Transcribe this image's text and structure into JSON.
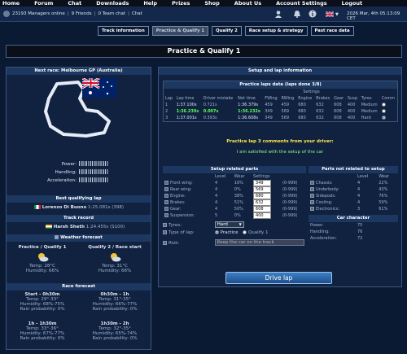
{
  "nav": [
    "Home",
    "Forum",
    "Chat",
    "Downloads",
    "Help",
    "Prizes",
    "Shop",
    "About Us",
    "Account Settings",
    "Logout"
  ],
  "status": {
    "managers_online": "23193 Managers online",
    "friends": "9 Friends",
    "team_chat": "0 Team chat",
    "chat": "Chat",
    "datetime": "2026 Mar, 4th 05:13:09 CET"
  },
  "tabs": [
    "Track information",
    "Practice & Qualify 1",
    "Qualify 2",
    "Race setup & strategy",
    "Past race data"
  ],
  "page_title": "Practice & Qualify 1",
  "left": {
    "next_race": "Next race: Melbourne GP (Australia)",
    "attributes": [
      {
        "label": "Power:",
        "level": 0.3
      },
      {
        "label": "Handling:",
        "level": 0.3
      },
      {
        "label": "Acceleration:",
        "level": 0.3
      }
    ],
    "best_qual_header": "Best qualifying lap",
    "best_qual_driver": "Lorenzo Di Buono",
    "best_qual_time": "1:25.081s (398)",
    "track_record_header": "Track record",
    "track_record_driver": "Harsh Sheth",
    "track_record_time": "1:24.455s (S100)",
    "weather_header": "Weather forecast",
    "weather_cols": [
      {
        "title": "Practice / Qualify 1",
        "temp": "Temp: 28°C",
        "humidity": "Humidity: 66%"
      },
      {
        "title": "Qualify 2 / Race start",
        "temp": "Temp: 31°C",
        "humidity": "Humidity: 66%"
      }
    ],
    "race_forecast_header": "Race forecast",
    "race_forecast": [
      {
        "title": "Start - 0h30m",
        "temp": "Temp: 29°-33°",
        "humidity": "Humidity: 68%-75%",
        "rain": "Rain probability: 0%"
      },
      {
        "title": "0h30m - 1h",
        "temp": "Temp: 31°-35°",
        "humidity": "Humidity: 66%-77%",
        "rain": "Rain probability: 0%"
      },
      {
        "title": "1h - 1h30m",
        "temp": "Temp: 33°-36°",
        "humidity": "Humidity: 67%-77%",
        "rain": "Rain probability: 0%"
      },
      {
        "title": "1h30m - 2h",
        "temp": "Temp: 32°-35°",
        "humidity": "Humidity: 65%-74%",
        "rain": "Rain probability: 0%"
      }
    ]
  },
  "right": {
    "setup_header": "Setup and lap information",
    "laps_header": "Practice laps data (laps done 3/8)",
    "settings_label": "Settings",
    "lap_cols": [
      "Lap",
      "Lap time",
      "Driver mistake",
      "Net time",
      "FWing",
      "RWing",
      "Engine",
      "Brakes",
      "Gear",
      "Susp",
      "Tyres",
      "Comm"
    ],
    "laps": [
      {
        "lap": "1",
        "time": "1:37.100s",
        "mistake": "0.721s",
        "net": "1:36.379s",
        "fw": "459",
        "rw": "459",
        "eng": "680",
        "brk": "632",
        "gear": "608",
        "susp": "400",
        "tyres": "Medium",
        "selected": false,
        "best": false
      },
      {
        "lap": "2",
        "time": "1:36.239s",
        "mistake": "0.007s",
        "net": "1:36.232s",
        "fw": "349",
        "rw": "569",
        "eng": "680",
        "brk": "632",
        "gear": "608",
        "susp": "400",
        "tyres": "Medium",
        "selected": false,
        "best": true
      },
      {
        "lap": "3",
        "time": "1:37.001s",
        "mistake": "0.393s",
        "net": "1:36.608s",
        "fw": "349",
        "rw": "569",
        "eng": "680",
        "brk": "632",
        "gear": "608",
        "susp": "400",
        "tyres": "Hard",
        "selected": true,
        "best": false
      }
    ],
    "comment_header": "Practice lap 3 comments from your driver:",
    "comment": "I am satisfied with the setup of the car",
    "setup_parts_header": "Setup related parts",
    "non_setup_header": "Parts not related to setup",
    "col_level": "Level",
    "col_wear": "Wear",
    "col_settings": "Settings",
    "setup_parts": [
      {
        "name": "Front wing:",
        "level": "4",
        "wear": "16%",
        "value": "349",
        "range": "(0-999)"
      },
      {
        "name": "Rear wing:",
        "level": "4",
        "wear": "0%",
        "value": "569",
        "range": "(0-999)"
      },
      {
        "name": "Engine:",
        "level": "4",
        "wear": "38%",
        "value": "680",
        "range": "(0-999)"
      },
      {
        "name": "Brakes:",
        "level": "4",
        "wear": "51%",
        "value": "632",
        "range": "(0-999)"
      },
      {
        "name": "Gear:",
        "level": "4",
        "wear": "50%",
        "value": "608",
        "range": "(0-999)"
      },
      {
        "name": "Suspension:",
        "level": "5",
        "wear": "0%",
        "value": "400",
        "range": "(0-999)"
      }
    ],
    "non_setup": [
      {
        "name": "Chassis:",
        "level": "4",
        "wear": "22%"
      },
      {
        "name": "Underbody:",
        "level": "4",
        "wear": "43%"
      },
      {
        "name": "Sidepods:",
        "level": "4",
        "wear": "76%"
      },
      {
        "name": "Cooling:",
        "level": "4",
        "wear": "59%"
      },
      {
        "name": "Electronics:",
        "level": "3",
        "wear": "61%"
      }
    ],
    "tyres_label": "Tyres:",
    "tyres_value": "Hard",
    "type_label": "Type of lap:",
    "type_options": [
      "Practice",
      "Qualify 1"
    ],
    "risk_label": "Risk:",
    "risk_value": "Keep the car on the track",
    "character_header": "Car character",
    "character": [
      {
        "name": "Power:",
        "value": "75"
      },
      {
        "name": "Handling:",
        "value": "76"
      },
      {
        "name": "Acceleration:",
        "value": "72"
      }
    ],
    "drive_button": "Drive lap"
  }
}
